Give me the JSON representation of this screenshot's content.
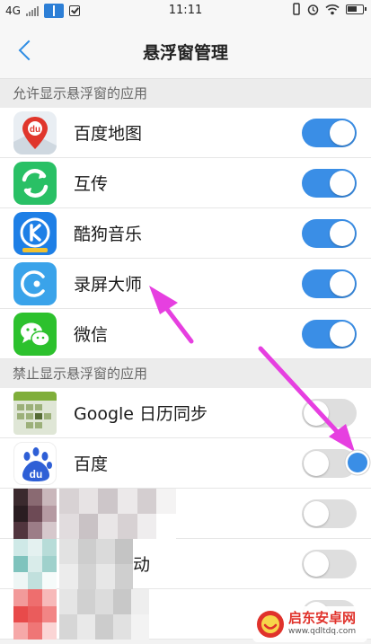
{
  "status_bar": {
    "network": "4G",
    "time": "11:11"
  },
  "nav": {
    "title": "悬浮窗管理"
  },
  "sections": {
    "allowed": {
      "title": "允许显示悬浮窗的应用",
      "apps": [
        {
          "label": "百度地图",
          "icon": "baidu-map-icon",
          "toggle": "on"
        },
        {
          "label": "互传",
          "icon": "transfer-icon",
          "toggle": "on"
        },
        {
          "label": "酷狗音乐",
          "icon": "kugou-icon",
          "toggle": "on"
        },
        {
          "label": "录屏大师",
          "icon": "screen-recorder-icon",
          "toggle": "on"
        },
        {
          "label": "微信",
          "icon": "wechat-icon",
          "toggle": "on"
        }
      ]
    },
    "blocked": {
      "title": "禁止显示悬浮窗的应用",
      "apps": [
        {
          "label": "Google 日历同步",
          "icon": "google-calendar-sync-icon",
          "toggle": "off"
        },
        {
          "label": "百度",
          "icon": "baidu-icon",
          "toggle": "off"
        },
        {
          "label": "",
          "icon": "redacted-icon",
          "toggle": "off"
        },
        {
          "label": "动",
          "icon": "redacted-icon",
          "toggle": "off"
        },
        {
          "label": "",
          "icon": "redacted-icon",
          "toggle": "off"
        }
      ]
    }
  },
  "colors": {
    "accent": "#3a8ee6",
    "toggle_off": "#dedede",
    "annotation_arrow": "#e63fe0"
  },
  "watermark": {
    "title": "启东安卓网",
    "url": "www.qdltdq.com"
  }
}
